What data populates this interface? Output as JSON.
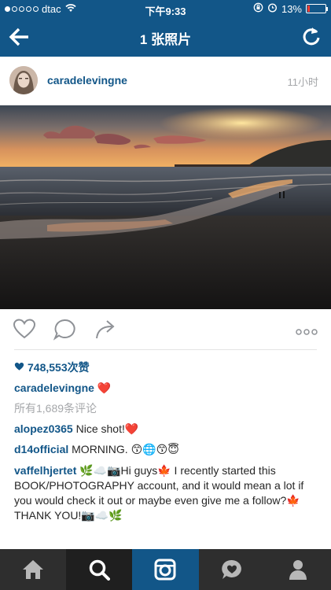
{
  "status_bar": {
    "carrier": "dtac",
    "time": "下午9:33",
    "battery": "13%",
    "battery_level": 0.13,
    "icons": [
      "signal-dots-icon",
      "wifi-icon",
      "rotation-lock-icon",
      "alarm-icon",
      "battery-icon"
    ]
  },
  "nav": {
    "title": "1 张照片",
    "back_icon": "back-arrow-icon",
    "refresh_icon": "refresh-icon"
  },
  "post": {
    "username": "caradelevingne",
    "time_ago": "11小时",
    "likes": "748,553次赞",
    "caption_user": "caradelevingne",
    "caption_text": "❤️",
    "view_comments": "所有1,689条评论",
    "actions": [
      "like-heart-icon",
      "comment-icon",
      "share-arrow-icon",
      "more-options-icon"
    ],
    "comments": [
      {
        "user": "alopez0365",
        "text": "Nice shot!❤️"
      },
      {
        "user": "d14official",
        "text": "MORNING. 😙🌐😙😇"
      },
      {
        "user": "vaffelhjertet",
        "text": "🌿☁️📷Hi guys🍁 I recently started this BOOK/PHOTOGRAPHY account, and it would mean a lot if you would check it out or maybe even give me a follow?🍁 THANK YOU!📷☁️🌿"
      }
    ]
  },
  "tabbar": {
    "tabs": [
      "home-icon",
      "search-icon",
      "camera-icon",
      "activity-heart-icon",
      "profile-icon"
    ],
    "active": "camera-icon"
  },
  "colors": {
    "brand": "#125688",
    "username": "#125688",
    "like_heart": "#e0245e",
    "tabbar": "#2e2e2e"
  }
}
